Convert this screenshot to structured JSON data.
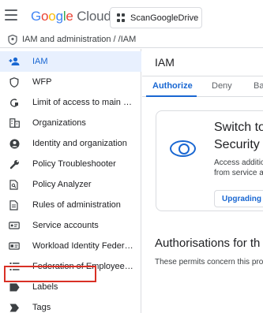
{
  "header": {
    "logo_letters": [
      "G",
      "o",
      "o",
      "g",
      "l",
      "e"
    ],
    "logo_suffix": "Cloud",
    "project_name": "ScanGoogleDrive"
  },
  "breadcrumb": {
    "text": "IAM and administration  / /IAM"
  },
  "sidebar": {
    "items": [
      {
        "label": "IAM",
        "icon": "add-person-icon",
        "active": true
      },
      {
        "label": "WFP",
        "icon": "shield-icon"
      },
      {
        "label": "Limit of access to main a...",
        "icon": "access-limit-icon"
      },
      {
        "label": "Organizations",
        "icon": "building-icon"
      },
      {
        "label": "Identity and organization",
        "icon": "account-circle-icon"
      },
      {
        "label": "Policy Troubleshooter",
        "icon": "wrench-icon"
      },
      {
        "label": "Policy Analyzer",
        "icon": "document-search-icon"
      },
      {
        "label": "Rules of administration",
        "icon": "document-icon"
      },
      {
        "label": "Service accounts",
        "icon": "service-account-icon"
      },
      {
        "label": "Workload Identity Federat...",
        "icon": "id-card-icon"
      },
      {
        "label": "Federation of Employee Id...",
        "icon": "list-icon"
      },
      {
        "label": "Labels",
        "icon": "label-icon"
      },
      {
        "label": "Tags",
        "icon": "tag-icon"
      }
    ]
  },
  "main": {
    "title": "IAM",
    "tabs": [
      "Authorize",
      "Deny",
      "Ba"
    ],
    "card": {
      "title_line1": "Switch to",
      "title_line2": "Security",
      "text_line1": "Access additio",
      "text_line2": "from service a",
      "button": "Upgrading"
    },
    "section_title": "Authorisations for th",
    "section_text": "These permits concern this pro"
  },
  "colors": {
    "accent": "#1967d2",
    "active_bg": "#e8f0fe",
    "highlight": "#d93025"
  }
}
